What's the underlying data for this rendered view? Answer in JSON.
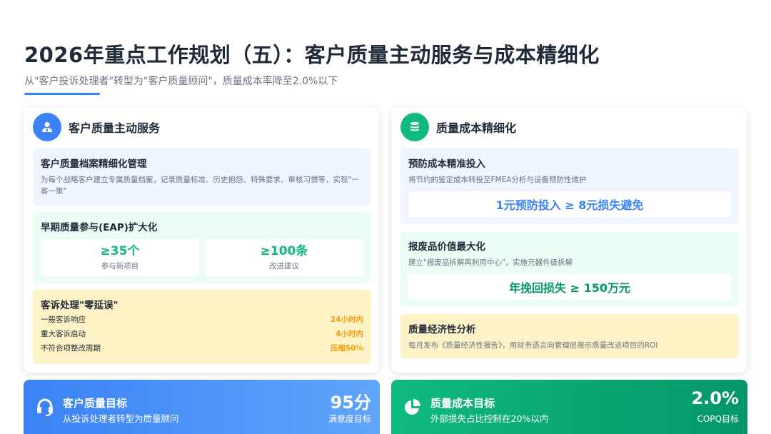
{
  "page": {
    "title": "2026年重点工作规划（五）：客户质量主动服务与成本精细化",
    "subtitle": "从\"客户投诉处理者\"转型为\"客户质量顾问\"，质量成本率降至2.0%以下"
  },
  "left_card": {
    "title": "客户质量主动服务",
    "icon": "user-icon",
    "s1": {
      "title": "客户质量档案精细化管理",
      "desc": "为每个战略客户建立专属质量档案，记录质量标准、历史抱怨、特殊要求、审核习惯等，实现\"一客一策\""
    },
    "s2": {
      "title": "早期质量参与(EAP)扩大化",
      "stats": [
        {
          "num": "≥35个",
          "label": "参与新项目"
        },
        {
          "num": "≥100条",
          "label": "改进建议"
        }
      ]
    },
    "s3": {
      "title": "客诉处理\"零延误\"",
      "rows": [
        {
          "k": "一般客诉响应",
          "v": "24小时内"
        },
        {
          "k": "重大客诉启动",
          "v": "4小时内"
        },
        {
          "k": "不符合项整改周期",
          "v": "压缩50%"
        }
      ]
    }
  },
  "right_card": {
    "title": "质量成本精细化",
    "icon": "coins-icon",
    "s1": {
      "title": "预防成本精准投入",
      "desc": "将节约的鉴定成本转投至FMEA分析与设备预防性维护",
      "highlight": "1元预防投入 ≥ 8元损失避免"
    },
    "s2": {
      "title": "报废品价值最大化",
      "desc": "建立\"报废品拆解再利用中心\"，实施元器件级拆解",
      "highlight": "年挽回损失 ≥ 150万元"
    },
    "s3": {
      "title": "质量经济性分析",
      "desc": "每月发布《质量经济性报告》，用财务语言向管理层展示质量改进项目的ROI"
    }
  },
  "bottom_left": {
    "title": "客户质量目标",
    "desc": "从投诉处理者转型为质量顾问",
    "num": "95分",
    "label": "满意度目标",
    "icon": "headset-icon"
  },
  "bottom_right": {
    "title": "质量成本目标",
    "desc": "外部损失占比控制在20%以内",
    "num": "2.0%",
    "label": "COPQ目标",
    "icon": "pie-chart-icon"
  },
  "colors": {
    "blue": "#3b82f6",
    "green": "#10b981",
    "amber": "#f59e0b"
  }
}
